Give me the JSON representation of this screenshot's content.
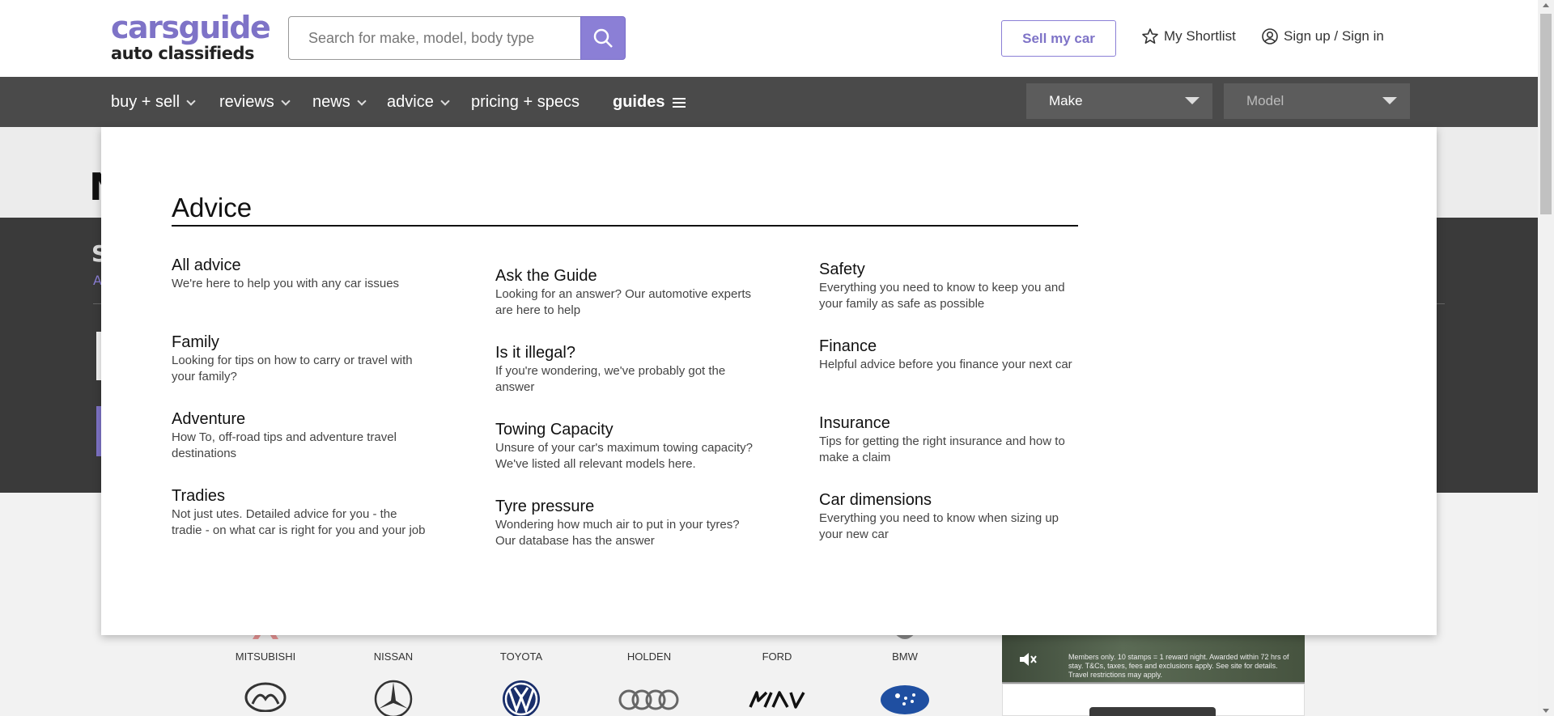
{
  "header": {
    "logo_line1": "carsguide",
    "logo_line2": "auto classifieds",
    "search_placeholder": "Search for make, model, body type",
    "sell_label": "Sell my car",
    "shortlist_label": "My Shortlist",
    "signin_label": "Sign up / Sign in"
  },
  "nav": {
    "items": [
      "buy + sell",
      "reviews",
      "news",
      "advice",
      "pricing + specs",
      "guides"
    ],
    "make_placeholder": "Make",
    "model_placeholder": "Model"
  },
  "background": {
    "title_partial": "N",
    "section_partial": "S",
    "link_partial": "A"
  },
  "brands": {
    "row1": [
      "MITSUBISHI",
      "NISSAN",
      "TOYOTA",
      "HOLDEN",
      "FORD",
      "BMW"
    ]
  },
  "video": {
    "caption": "Members only. 10 stamps = 1 reward night. Awarded within 72 hrs of stay. T&Cs, taxes, fees and exclusions apply. See site for details. Travel restrictions may apply."
  },
  "mega_menu": {
    "title": "Advice",
    "columns": [
      [
        {
          "title": "All advice",
          "desc": "We're here to help you with any car issues"
        },
        {
          "title": "Family",
          "desc": "Looking for tips on how to carry or travel with your family?"
        },
        {
          "title": "Adventure",
          "desc": "How To, off-road tips and adventure travel destinations"
        },
        {
          "title": "Tradies",
          "desc": "Not just utes. Detailed advice for you - the tradie - on what car is right for you and your job"
        }
      ],
      [
        {
          "title": "Ask the Guide",
          "desc": "Looking for an answer? Our automotive experts are here to help"
        },
        {
          "title": "Is it illegal?",
          "desc": "If you're wondering, we've probably got the answer"
        },
        {
          "title": "Towing Capacity",
          "desc": "Unsure of your car's maximum towing capacity? We've listed all relevant models here."
        },
        {
          "title": "Tyre pressure",
          "desc": "Wondering how much air to put in your tyres? Our database has the answer"
        }
      ],
      [
        {
          "title": "Safety",
          "desc": "Everything you need to know to keep you and your family as safe as possible"
        },
        {
          "title": "Finance",
          "desc": "Helpful advice before you finance your next car"
        },
        {
          "title": "Insurance",
          "desc": "Tips for getting the right insurance and how to make a claim"
        },
        {
          "title": "Car dimensions",
          "desc": "Everything you need to know when sizing up your new car"
        }
      ]
    ]
  },
  "colors": {
    "accent": "#8b7fd6",
    "nav_bg": "#4a4a4a"
  }
}
